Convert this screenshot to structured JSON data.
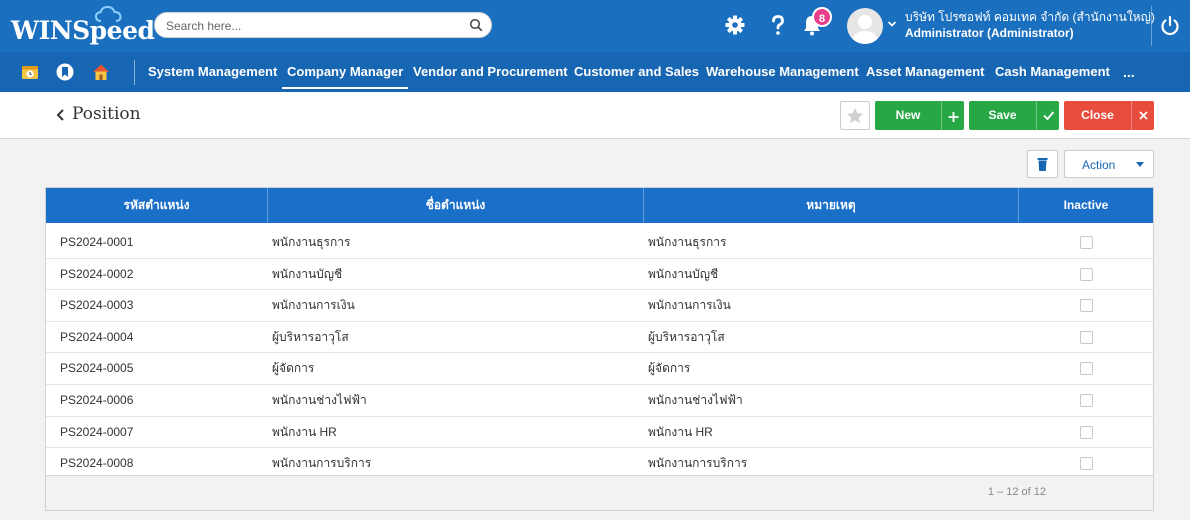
{
  "app": {
    "logo_text": "WINSpeed",
    "search_placeholder": "Search here...",
    "notification_count": "8",
    "company_name": "บริษัท โปรซอฟท์ คอมเทค จำกัด (สำนักงานใหญ่)",
    "user_name": "Administrator (Administrator)"
  },
  "colors": {
    "header_bg": "#1b6fbf",
    "nav_bg": "#1766b4",
    "grid_header_bg": "#1a6fc9",
    "success": "#28a745",
    "danger": "#e74c3c",
    "badge": "#e83e8c"
  },
  "nav": {
    "icons": [
      "calendar-clock-icon",
      "bookmark-icon",
      "home-icon"
    ],
    "items": [
      {
        "label": "System Management"
      },
      {
        "label": "Company Manager",
        "active": true
      },
      {
        "label": "Vendor and Procurement"
      },
      {
        "label": "Customer and Sales"
      },
      {
        "label": "Warehouse Management"
      },
      {
        "label": "Asset Management"
      },
      {
        "label": "Cash Management"
      }
    ],
    "more_label": "..."
  },
  "page": {
    "title": "Position",
    "buttons": {
      "new_label": "New",
      "save_label": "Save",
      "close_label": "Close"
    },
    "action_label": "Action"
  },
  "grid": {
    "columns": [
      "รหัสตำแหน่ง",
      "ชื่อตำแหน่ง",
      "หมายเหตุ",
      "Inactive"
    ],
    "rows": [
      {
        "code": "PS2024-0001",
        "name": "พนักงานธุรการ",
        "remark": "พนักงานธุรการ",
        "inactive": false
      },
      {
        "code": "PS2024-0002",
        "name": "พนักงานบัญชี",
        "remark": "พนักงานบัญชี",
        "inactive": false
      },
      {
        "code": "PS2024-0003",
        "name": "พนักงานการเงิน",
        "remark": "พนักงานการเงิน",
        "inactive": false
      },
      {
        "code": "PS2024-0004",
        "name": "ผู้บริหารอาวุโส",
        "remark": "ผู้บริหารอาวุโส",
        "inactive": false
      },
      {
        "code": "PS2024-0005",
        "name": "ผู้จัดการ",
        "remark": "ผู้จัดการ",
        "inactive": false
      },
      {
        "code": "PS2024-0006",
        "name": "พนักงานช่างไฟฟ้า",
        "remark": "พนักงานช่างไฟฟ้า",
        "inactive": false
      },
      {
        "code": "PS2024-0007",
        "name": "พนักงาน HR",
        "remark": "พนักงาน HR",
        "inactive": false
      },
      {
        "code": "PS2024-0008",
        "name": "พนักงานการบริการ",
        "remark": "พนักงานการบริการ",
        "inactive": false
      }
    ],
    "pager_text": "1 – 12 of 12"
  }
}
